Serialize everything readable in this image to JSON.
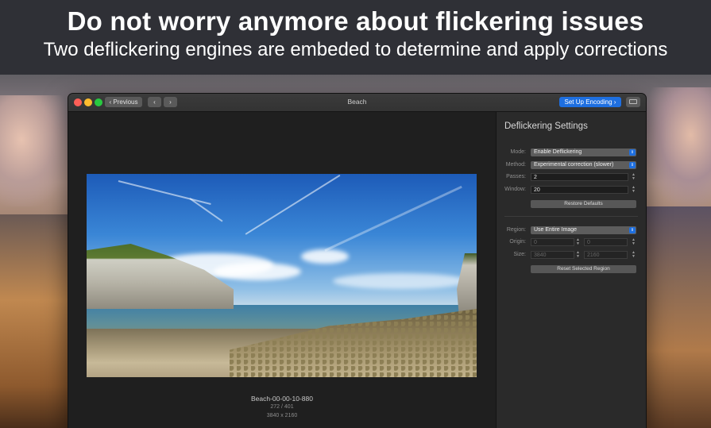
{
  "headline": {
    "title": "Do not worry anymore about flickering issues",
    "subtitle": "Two deflickering engines are embeded to determine and apply corrections"
  },
  "window": {
    "title": "Beach",
    "toolbar": {
      "previous_label": "Previous",
      "back_glyph": "‹",
      "forward_glyph": "›",
      "encode_label": "Set Up Encoding",
      "encode_glyph": "›"
    },
    "preview": {
      "frame_name": "Beach-00-00-10-880",
      "frame_position": "272 / 401",
      "dimensions": "3840 x 2160"
    }
  },
  "panel": {
    "title": "Deflickering Settings",
    "mode": {
      "label": "Mode:",
      "value": "Enable Deflickering"
    },
    "method": {
      "label": "Method:",
      "value": "Experimental correction (slower)"
    },
    "passes": {
      "label": "Passes:",
      "value": "2"
    },
    "window": {
      "label": "Window:",
      "value": "20"
    },
    "restore_label": "Restore Defaults",
    "region": {
      "label": "Region:",
      "value": "Use Entire Image"
    },
    "origin": {
      "label": "Origin:",
      "x": "0",
      "y": "0"
    },
    "size": {
      "label": "Size:",
      "w": "3840",
      "h": "2160"
    },
    "reset_region_label": "Reset Selected Region"
  },
  "colors": {
    "accent": "#1e6fe0",
    "close": "#ff5f57",
    "minimize": "#febc2e",
    "zoom": "#28c840"
  },
  "icons": [
    "chevron-left-icon",
    "chevron-right-icon",
    "sidebar-toggle-icon",
    "popup-arrows-icon",
    "stepper-icon"
  ]
}
